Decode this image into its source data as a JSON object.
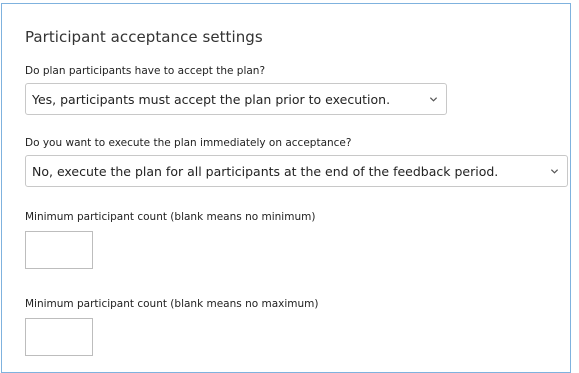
{
  "section": {
    "title": "Participant acceptance settings"
  },
  "accept_plan": {
    "label": "Do plan participants have to accept the plan?",
    "selected": "Yes, participants must accept the plan prior to execution."
  },
  "execute_immediately": {
    "label": "Do you want to execute the plan immediately on acceptance?",
    "selected": "No, execute the plan for all participants at the end of the feedback period."
  },
  "min_count": {
    "label": "Minimum participant count (blank means no minimum)",
    "value": ""
  },
  "max_count": {
    "label": "Minimum participant count (blank means no maximum)",
    "value": ""
  },
  "icons": {
    "dropdown": "chevron-down-icon"
  },
  "colors": {
    "panel_border": "#7fb2de",
    "field_border": "#c8c8c8",
    "text": "#222222"
  }
}
